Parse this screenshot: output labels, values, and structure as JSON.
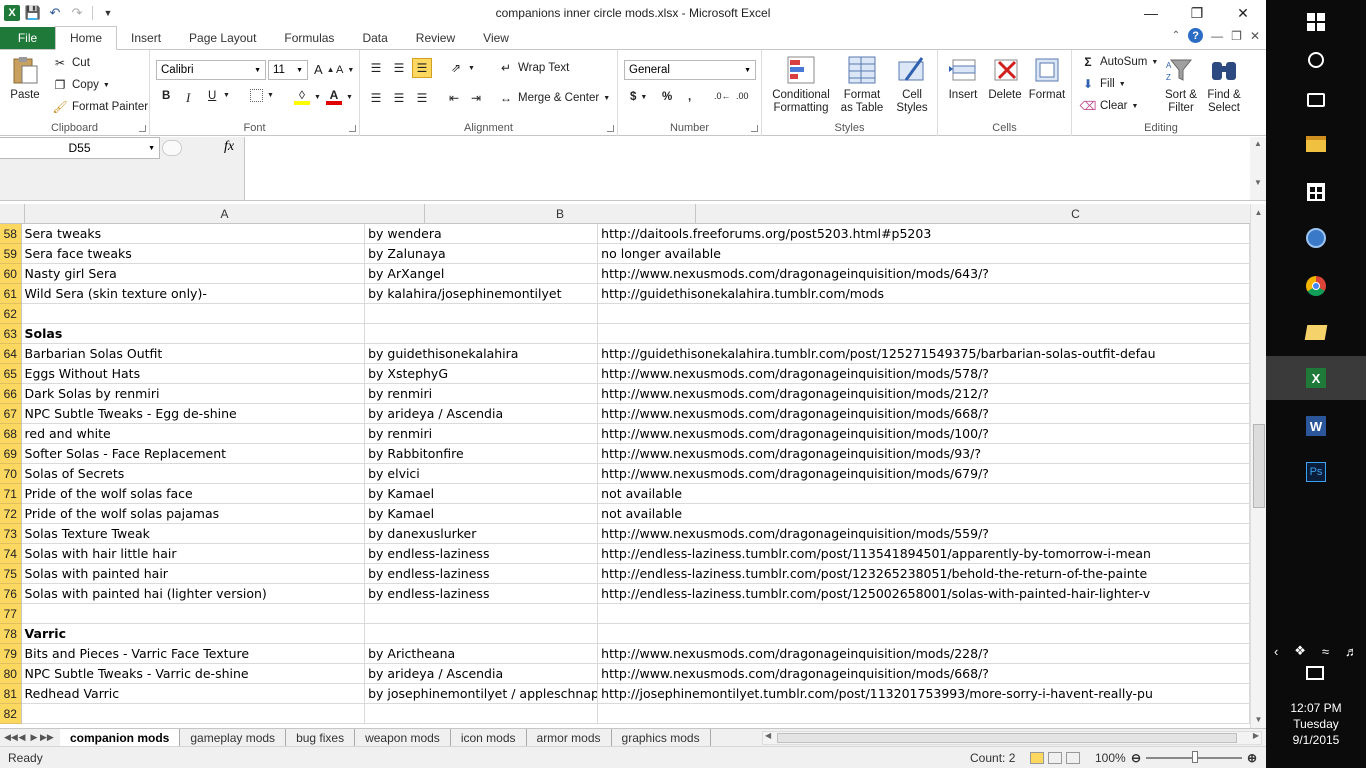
{
  "window": {
    "title": "companions inner circle mods.xlsx - Microsoft Excel"
  },
  "ribbon_tabs": [
    "File",
    "Home",
    "Insert",
    "Page Layout",
    "Formulas",
    "Data",
    "Review",
    "View"
  ],
  "ribbon": {
    "clipboard": {
      "paste": "Paste",
      "cut": "Cut",
      "copy": "Copy",
      "format_painter": "Format Painter",
      "label": "Clipboard"
    },
    "font": {
      "name": "Calibri",
      "size": "11",
      "label": "Font"
    },
    "alignment": {
      "wrap": "Wrap Text",
      "merge": "Merge & Center",
      "label": "Alignment"
    },
    "number": {
      "format": "General",
      "label": "Number"
    },
    "styles": {
      "conditional": "Conditional\nFormatting",
      "format_table": "Format\nas Table",
      "cell_styles": "Cell\nStyles",
      "label": "Styles"
    },
    "cells": {
      "insert": "Insert",
      "delete": "Delete",
      "format": "Format",
      "label": "Cells"
    },
    "editing": {
      "autosum": "AutoSum",
      "fill": "Fill",
      "clear": "Clear",
      "sort": "Sort &\nFilter",
      "find": "Find &\nSelect",
      "label": "Editing"
    }
  },
  "formula_bar": {
    "name_box": "D55",
    "formula": ""
  },
  "columns": [
    "A",
    "B",
    "C"
  ],
  "rows": [
    {
      "num": "58",
      "a": "Sera tweaks",
      "b": "by wendera",
      "c": "http://daitools.freeforums.org/post5203.html#p5203"
    },
    {
      "num": "59",
      "a": "Sera face tweaks",
      "b": "by Zalunaya",
      "c": "no longer available"
    },
    {
      "num": "60",
      "a": "Nasty girl Sera",
      "b": "by ArXangel",
      "c": "http://www.nexusmods.com/dragonageinquisition/mods/643/?"
    },
    {
      "num": "61",
      "a": "Wild Sera (skin texture only)-",
      "b": "by kalahira/josephinemontilyet",
      "c": "http://guidethisonekalahira.tumblr.com/mods"
    },
    {
      "num": "62",
      "a": "",
      "b": "",
      "c": ""
    },
    {
      "num": "63",
      "a": "Solas",
      "b": "",
      "c": "",
      "bold": true
    },
    {
      "num": "64",
      "a": "Barbarian Solas Outfit",
      "b": "by guidethisonekalahira",
      "c": "http://guidethisonekalahira.tumblr.com/post/125271549375/barbarian-solas-outfit-defau"
    },
    {
      "num": "65",
      "a": "Eggs Without Hats",
      "b": "by XstephyG",
      "c": "http://www.nexusmods.com/dragonageinquisition/mods/578/?"
    },
    {
      "num": "66",
      "a": "Dark Solas by renmiri",
      "b": "by renmiri",
      "c": "http://www.nexusmods.com/dragonageinquisition/mods/212/?"
    },
    {
      "num": "67",
      "a": "NPC Subtle Tweaks - Egg de-shine",
      "b": "by arideya / Ascendia",
      "c": "http://www.nexusmods.com/dragonageinquisition/mods/668/?"
    },
    {
      "num": "68",
      "a": "red and white",
      "b": "by renmiri",
      "c": "http://www.nexusmods.com/dragonageinquisition/mods/100/?"
    },
    {
      "num": "69",
      "a": "Softer Solas - Face Replacement",
      "b": "by Rabbitonfire",
      "c": "http://www.nexusmods.com/dragonageinquisition/mods/93/?"
    },
    {
      "num": "70",
      "a": "Solas of Secrets",
      "b": "by elvici",
      "c": "http://www.nexusmods.com/dragonageinquisition/mods/679/?"
    },
    {
      "num": "71",
      "a": "Pride of the wolf solas face",
      "b": "by Kamael",
      "c": "not available"
    },
    {
      "num": "72",
      "a": "Pride of the wolf solas pajamas",
      "b": "by Kamael",
      "c": "not available"
    },
    {
      "num": "73",
      "a": "Solas Texture Tweak",
      "b": "by danexuslurker",
      "c": "http://www.nexusmods.com/dragonageinquisition/mods/559/?"
    },
    {
      "num": "74",
      "a": "Solas with hair  little hair",
      "b": "by endless-laziness",
      "c": "http://endless-laziness.tumblr.com/post/113541894501/apparently-by-tomorrow-i-mean"
    },
    {
      "num": "75",
      "a": "Solas with painted hair",
      "b": "by endless-laziness",
      "c": "http://endless-laziness.tumblr.com/post/123265238051/behold-the-return-of-the-painte"
    },
    {
      "num": "76",
      "a": "Solas with painted hai (lighter version)",
      "b": "by endless-laziness",
      "c": "http://endless-laziness.tumblr.com/post/125002658001/solas-with-painted-hair-lighter-v"
    },
    {
      "num": "77",
      "a": "",
      "b": "",
      "c": ""
    },
    {
      "num": "78",
      "a": "Varric",
      "b": "",
      "c": "",
      "bold": true
    },
    {
      "num": "79",
      "a": "Bits and Pieces - Varric Face Texture",
      "b": "by Arictheana",
      "c": "http://www.nexusmods.com/dragonageinquisition/mods/228/?"
    },
    {
      "num": "80",
      "a": "NPC Subtle Tweaks - Varric de-shine",
      "b": "by arideya / Ascendia",
      "c": "http://www.nexusmods.com/dragonageinquisition/mods/668/?"
    },
    {
      "num": "81",
      "a": "Redhead Varric",
      "b": "by josephinemontilyet / appleschnapple",
      "c": "http://josephinemontilyet.tumblr.com/post/113201753993/more-sorry-i-havent-really-pu"
    },
    {
      "num": "82",
      "a": "",
      "b": "",
      "c": ""
    }
  ],
  "sheet_tabs": [
    "companion mods",
    "gameplay mods",
    "bug fixes",
    "weapon mods",
    "icon mods",
    "armor mods",
    "graphics mods"
  ],
  "status": {
    "ready": "Ready",
    "count": "Count: 2",
    "zoom": "100%"
  },
  "clock": {
    "time": "12:07 PM",
    "day": "Tuesday",
    "date": "9/1/2015"
  },
  "colors": {
    "file_tab": "#1f7a3a",
    "row_header": "#fcd860",
    "taskbar": "#0b0b0b"
  }
}
